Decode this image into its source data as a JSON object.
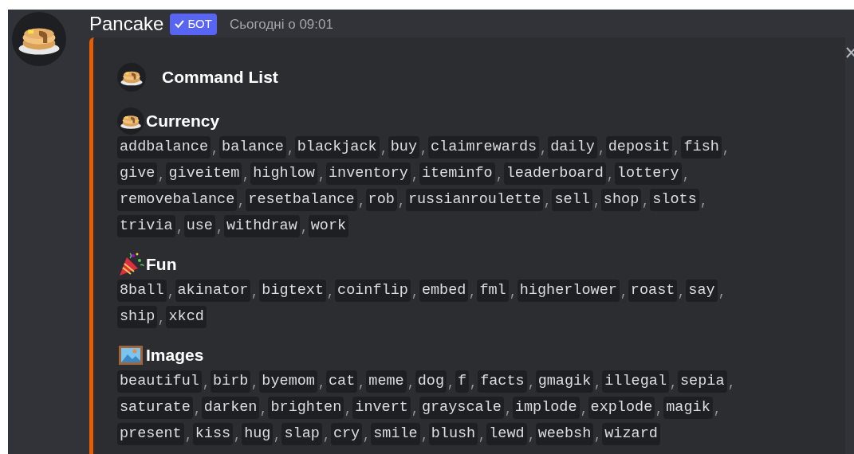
{
  "message": {
    "author": "Pancake",
    "badge": "БОТ",
    "timestamp": "Сьогодні о 09:01"
  },
  "embed": {
    "title": "Command List",
    "categories": [
      {
        "kind": "pancake",
        "name": "Currency",
        "lines": [
          [
            "addbalance",
            "balance",
            "blackjack",
            "buy",
            "claimrewards",
            "daily",
            "deposit",
            "fish"
          ],
          [
            "give",
            "giveitem",
            "highlow",
            "inventory",
            "iteminfo",
            "leaderboard",
            "lottery"
          ],
          [
            "removebalance",
            "resetbalance",
            "rob",
            "russianroulette",
            "sell",
            "shop",
            "slots"
          ],
          [
            "trivia",
            "use",
            "withdraw",
            "work"
          ]
        ]
      },
      {
        "kind": "party",
        "name": "Fun",
        "lines": [
          [
            "8ball",
            "akinator",
            "bigtext",
            "coinflip",
            "embed",
            "fml",
            "higherlower",
            "roast",
            "say"
          ],
          [
            "ship",
            "xkcd"
          ]
        ]
      },
      {
        "kind": "image",
        "name": "Images",
        "lines": [
          [
            "beautiful",
            "birb",
            "byemom",
            "cat",
            "meme",
            "dog",
            "f",
            "facts",
            "gmagik",
            "illegal",
            "sepia"
          ],
          [
            "saturate",
            "darken",
            "brighten",
            "invert",
            "grayscale",
            "implode",
            "explode",
            "magik"
          ],
          [
            "present",
            "kiss",
            "hug",
            "slap",
            "cry",
            "smile",
            "blush",
            "lewd",
            "weebsh",
            "wizard"
          ]
        ]
      }
    ]
  }
}
